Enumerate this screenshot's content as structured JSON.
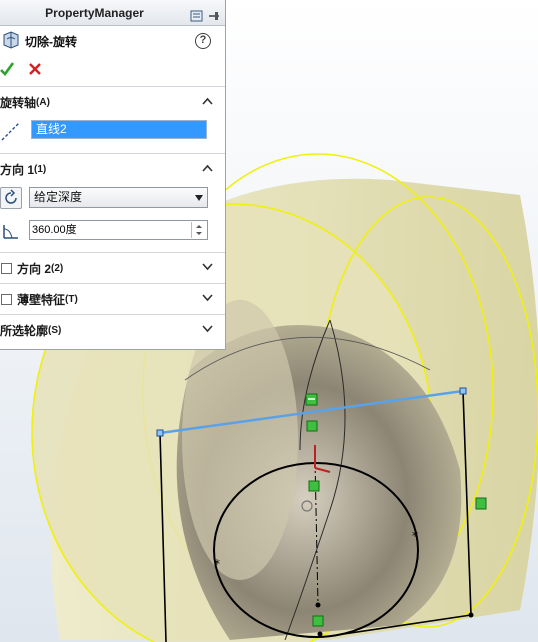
{
  "panel": {
    "title": "PropertyManager",
    "feature_name": "切除-旋转",
    "help_glyph": "?",
    "ok_icon": "checkmark-icon",
    "cancel_icon": "x-icon"
  },
  "groups": {
    "axis": {
      "label": "旋转轴",
      "key": "(A)",
      "value": "直线2"
    },
    "dir1": {
      "label": "方向 1",
      "key": "(1)",
      "end_condition": "给定深度",
      "angle": "360.00度"
    },
    "dir2": {
      "label": "方向 2",
      "key": "(2)"
    },
    "thin": {
      "label": "薄壁特征",
      "key": "(T)"
    },
    "contours": {
      "label": "所选轮廓",
      "key": "(S)"
    }
  },
  "colors": {
    "accent_blue": "#3399ff",
    "ok_green": "#2aa52a",
    "cancel_red": "#d42020",
    "model_fill": "#d9d6a9",
    "edge_yellow": "#f2f200"
  }
}
